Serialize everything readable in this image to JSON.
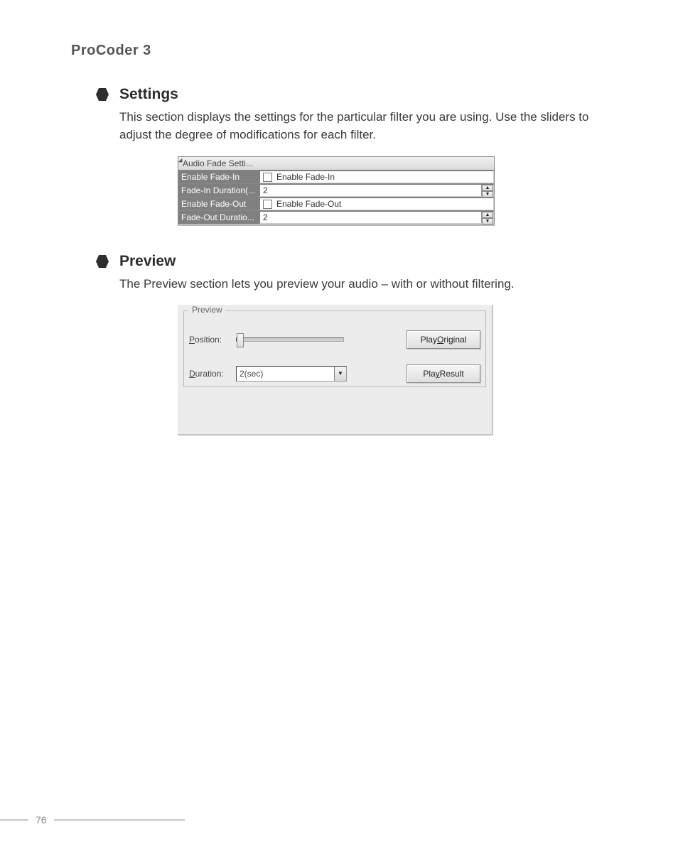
{
  "header": {
    "title": "ProCoder 3"
  },
  "sections": {
    "settings": {
      "title": "Settings",
      "body": "This section displays the settings for the particular filter you are using. Use the sliders to adjust the degree of modifications for each filter.",
      "table": {
        "category": "Audio Fade Setti...",
        "rows": {
          "enable_in": {
            "label": "Enable Fade-In",
            "value_text": "Enable Fade-In"
          },
          "dur_in": {
            "label": "Fade-In Duration(...",
            "value_text": "2"
          },
          "enable_out": {
            "label": "Enable Fade-Out",
            "value_text": "Enable Fade-Out"
          },
          "dur_out": {
            "label": "Fade-Out Duratio...",
            "value_text": "2"
          }
        }
      }
    },
    "preview": {
      "title": "Preview",
      "body": "The Preview section lets you preview your audio – with or without filtering.",
      "panel": {
        "legend": "Preview",
        "position_label_pre": "P",
        "position_label_post": "osition:",
        "duration_label_pre": "D",
        "duration_label_post": "uration:",
        "duration_value": "2(sec)",
        "btn_original_pre": "Play ",
        "btn_original_u": "O",
        "btn_original_post": "riginal",
        "btn_result_pre": "Pla",
        "btn_result_u": "y",
        "btn_result_post": " Result"
      }
    }
  },
  "footer": {
    "page_number": "76"
  }
}
